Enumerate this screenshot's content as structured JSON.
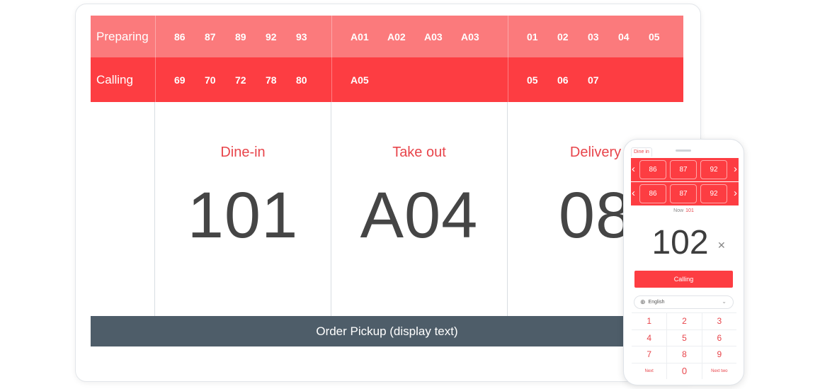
{
  "rows": {
    "preparing": {
      "label": "Preparing",
      "dine_in": [
        "86",
        "87",
        "89",
        "92",
        "93"
      ],
      "take_out": [
        "A01",
        "A02",
        "A03",
        "A03"
      ],
      "delivery": [
        "01",
        "02",
        "03",
        "04",
        "05"
      ]
    },
    "calling": {
      "label": "Calling",
      "dine_in": [
        "69",
        "70",
        "72",
        "78",
        "80"
      ],
      "take_out": [
        "A05"
      ],
      "delivery": [
        "05",
        "06",
        "07"
      ]
    }
  },
  "columns": [
    {
      "title": "Dine-in",
      "number": "101"
    },
    {
      "title": "Take out",
      "number": "A04"
    },
    {
      "title": "Delivery",
      "number": "08"
    }
  ],
  "footer": "Order Pickup (display text)",
  "phone": {
    "tab": "Dine in",
    "row1": [
      "86",
      "87",
      "92"
    ],
    "row2": [
      "86",
      "87",
      "92"
    ],
    "now_label": "Now",
    "now_value": "101",
    "current_number": "102",
    "calling_button": "Calling",
    "language": "English",
    "keys": [
      "1",
      "2",
      "3",
      "4",
      "5",
      "6",
      "7",
      "8",
      "9",
      "Next",
      "0",
      "Next two"
    ]
  },
  "colors": {
    "preparing_bg": "#fb7a7c",
    "calling_bg": "#fd3d42",
    "accent": "#e8454b",
    "footer_bg": "#4e5d69",
    "number_text": "#454545"
  }
}
